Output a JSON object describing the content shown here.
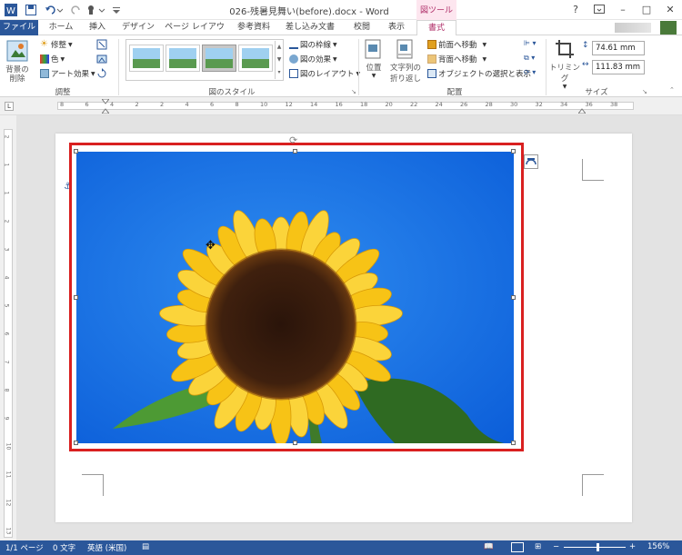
{
  "window": {
    "title": "026-残暑見舞い(before).docx - Word",
    "context_tab": "図ツール",
    "account_name": "",
    "minimize": "–",
    "restore": "□",
    "close": "✕",
    "help": "?"
  },
  "tabs": {
    "file": "ファイル",
    "home": "ホーム",
    "insert": "挿入",
    "design": "デザイン",
    "layout": "ページ レイアウト",
    "references": "参考資料",
    "mailings": "差し込み文書",
    "review": "校閲",
    "view": "表示",
    "format": "書式"
  },
  "ribbon": {
    "adjust": {
      "remove_bg": "背景の削除",
      "corrections": "修整",
      "color": "色",
      "artistic": "アート効果",
      "group_label": "調整"
    },
    "styles": {
      "group_label": "図のスタイル",
      "border": "図の枠線",
      "effects": "図の効果",
      "layout": "図のレイアウト"
    },
    "arrange": {
      "position": "位置",
      "wrap_text_line1": "文字列の",
      "wrap_text_line2": "折り返し",
      "bring_forward": "前面へ移動",
      "send_backward": "背面へ移動",
      "selection_pane": "オブジェクトの選択と表示",
      "group_label": "配置"
    },
    "size": {
      "crop": "トリミング",
      "height": "74.61 mm",
      "width": "111.83 mm",
      "group_label": "サイズ"
    }
  },
  "hruler": [
    "8",
    "6",
    "4",
    "2",
    "2",
    "4",
    "6",
    "8",
    "10",
    "12",
    "14",
    "16",
    "18",
    "20",
    "22",
    "24",
    "26",
    "28",
    "30",
    "32",
    "34",
    "36",
    "38"
  ],
  "vruler": [
    "2",
    "1",
    "1",
    "2",
    "3",
    "4",
    "5",
    "6",
    "7",
    "8",
    "9",
    "10",
    "11",
    "12",
    "13"
  ],
  "status": {
    "page": "1/1 ページ",
    "words": "0 文字",
    "language": "英語 (米国)",
    "zoom": "156%",
    "zoom_minus": "−",
    "zoom_plus": "+"
  },
  "colors": {
    "accent": "#2b579a",
    "highlight": "#d92020",
    "context_tab": "#b0306a"
  }
}
